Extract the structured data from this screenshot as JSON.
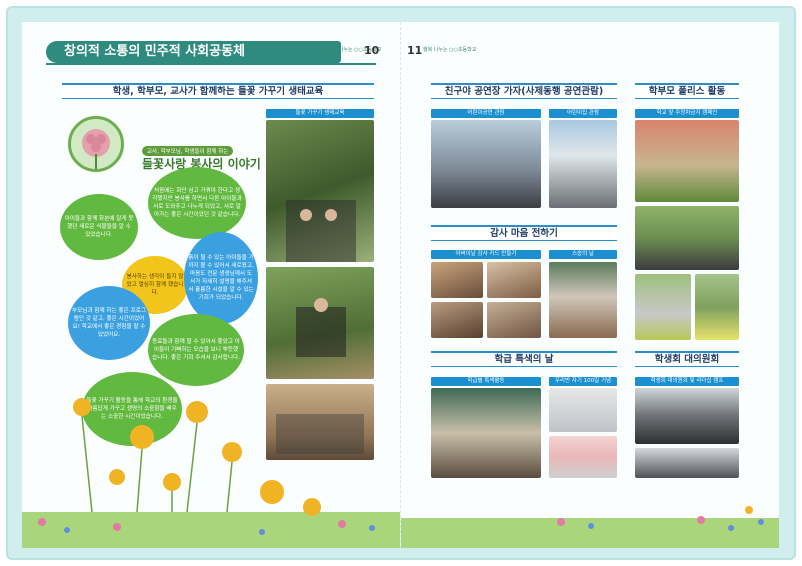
{
  "left_page": {
    "banner_title": "창의적 소통의 민주적 사회공동체",
    "page_number": "10",
    "page_meta": "행복 나누는 ○○초등학교",
    "section_title": "학생, 학부모, 교사가 함께하는 들꽃 가꾸기 생태교육",
    "photo_caption": "들꽃 가꾸기 생태교육",
    "story_tag": "교사, 학부모님, 학생들이 함께 하는",
    "story_title": "들꽃사랑 봉사의 이야기",
    "bubbles": [
      "아이들과 함께 화분에 알게 못했던 새로운 식물들을 알 수 있었습니다.",
      "처음에는 화단 심고 가꿔야 한다고 생각했지만 봉사를 하면서 다른 아이들과 서로 도와주고 나누게 되었고, 서로 알아가는 좋은 시간이었던 것 같습니다.",
      "봉사하는 생각이 들지 않았고 열심히 함께 했습니다.",
      "흙이 될 수 있는 아이들을 기까지 볼 수 있어서 새로웠고, 마음도 전문 생생님께서 도서가 자세히 설명을 해주셔서 훌륭한 시설을 알 수 있는 기회가 되었습니다.",
      "부모님과 함께 하는 좋은 프로그램인 것 같고, 좋은 시간이었어요! 학교에서 좋은 경험을 할 수 있었어요.",
      "동료들과 함께 할 수 있어서 좋았고 아이들이 기뻐하는 모습을 보니 뿌듯했습니다. 좋은 기회 주셔서 감사합니다.",
      "들꽃 가꾸기 활동을 통해 학교의 환경을 아름답게 가꾸고 생명의 소중함을 배우는 소중한 시간이었습니다."
    ]
  },
  "right_page": {
    "page_number": "11",
    "page_meta": "행복 나누는 ○○초등학교",
    "sections": [
      {
        "title": "친구야 공연장 가자(사제동행 공연관람)",
        "captions": [
          "어린이공연 관람",
          "어린이집 관람"
        ]
      },
      {
        "title": "학부모 폴리스 활동",
        "captions": [
          "학교 앞 주정차금지 캠페인"
        ]
      },
      {
        "title": "감사 마음 전하기",
        "captions": [
          "어버이날 감사 카드 만들기",
          "스승의 날"
        ]
      },
      {
        "title": "학급 특색의 날",
        "captions": [
          "학급별 특색활동",
          "우리반 자기 100일 기념"
        ]
      },
      {
        "title": "학생회 대의원회",
        "captions": [
          "학생회 대의원회 및 리더십 캠프"
        ]
      }
    ]
  },
  "colors": {
    "banner": "#2e8b7e",
    "section_rule": "#2a8fc8",
    "caption_bar": "#1b8fd0",
    "bubble_green": "#62b93f",
    "bubble_blue": "#3aa0e0",
    "bubble_yellow": "#f2c51c"
  }
}
